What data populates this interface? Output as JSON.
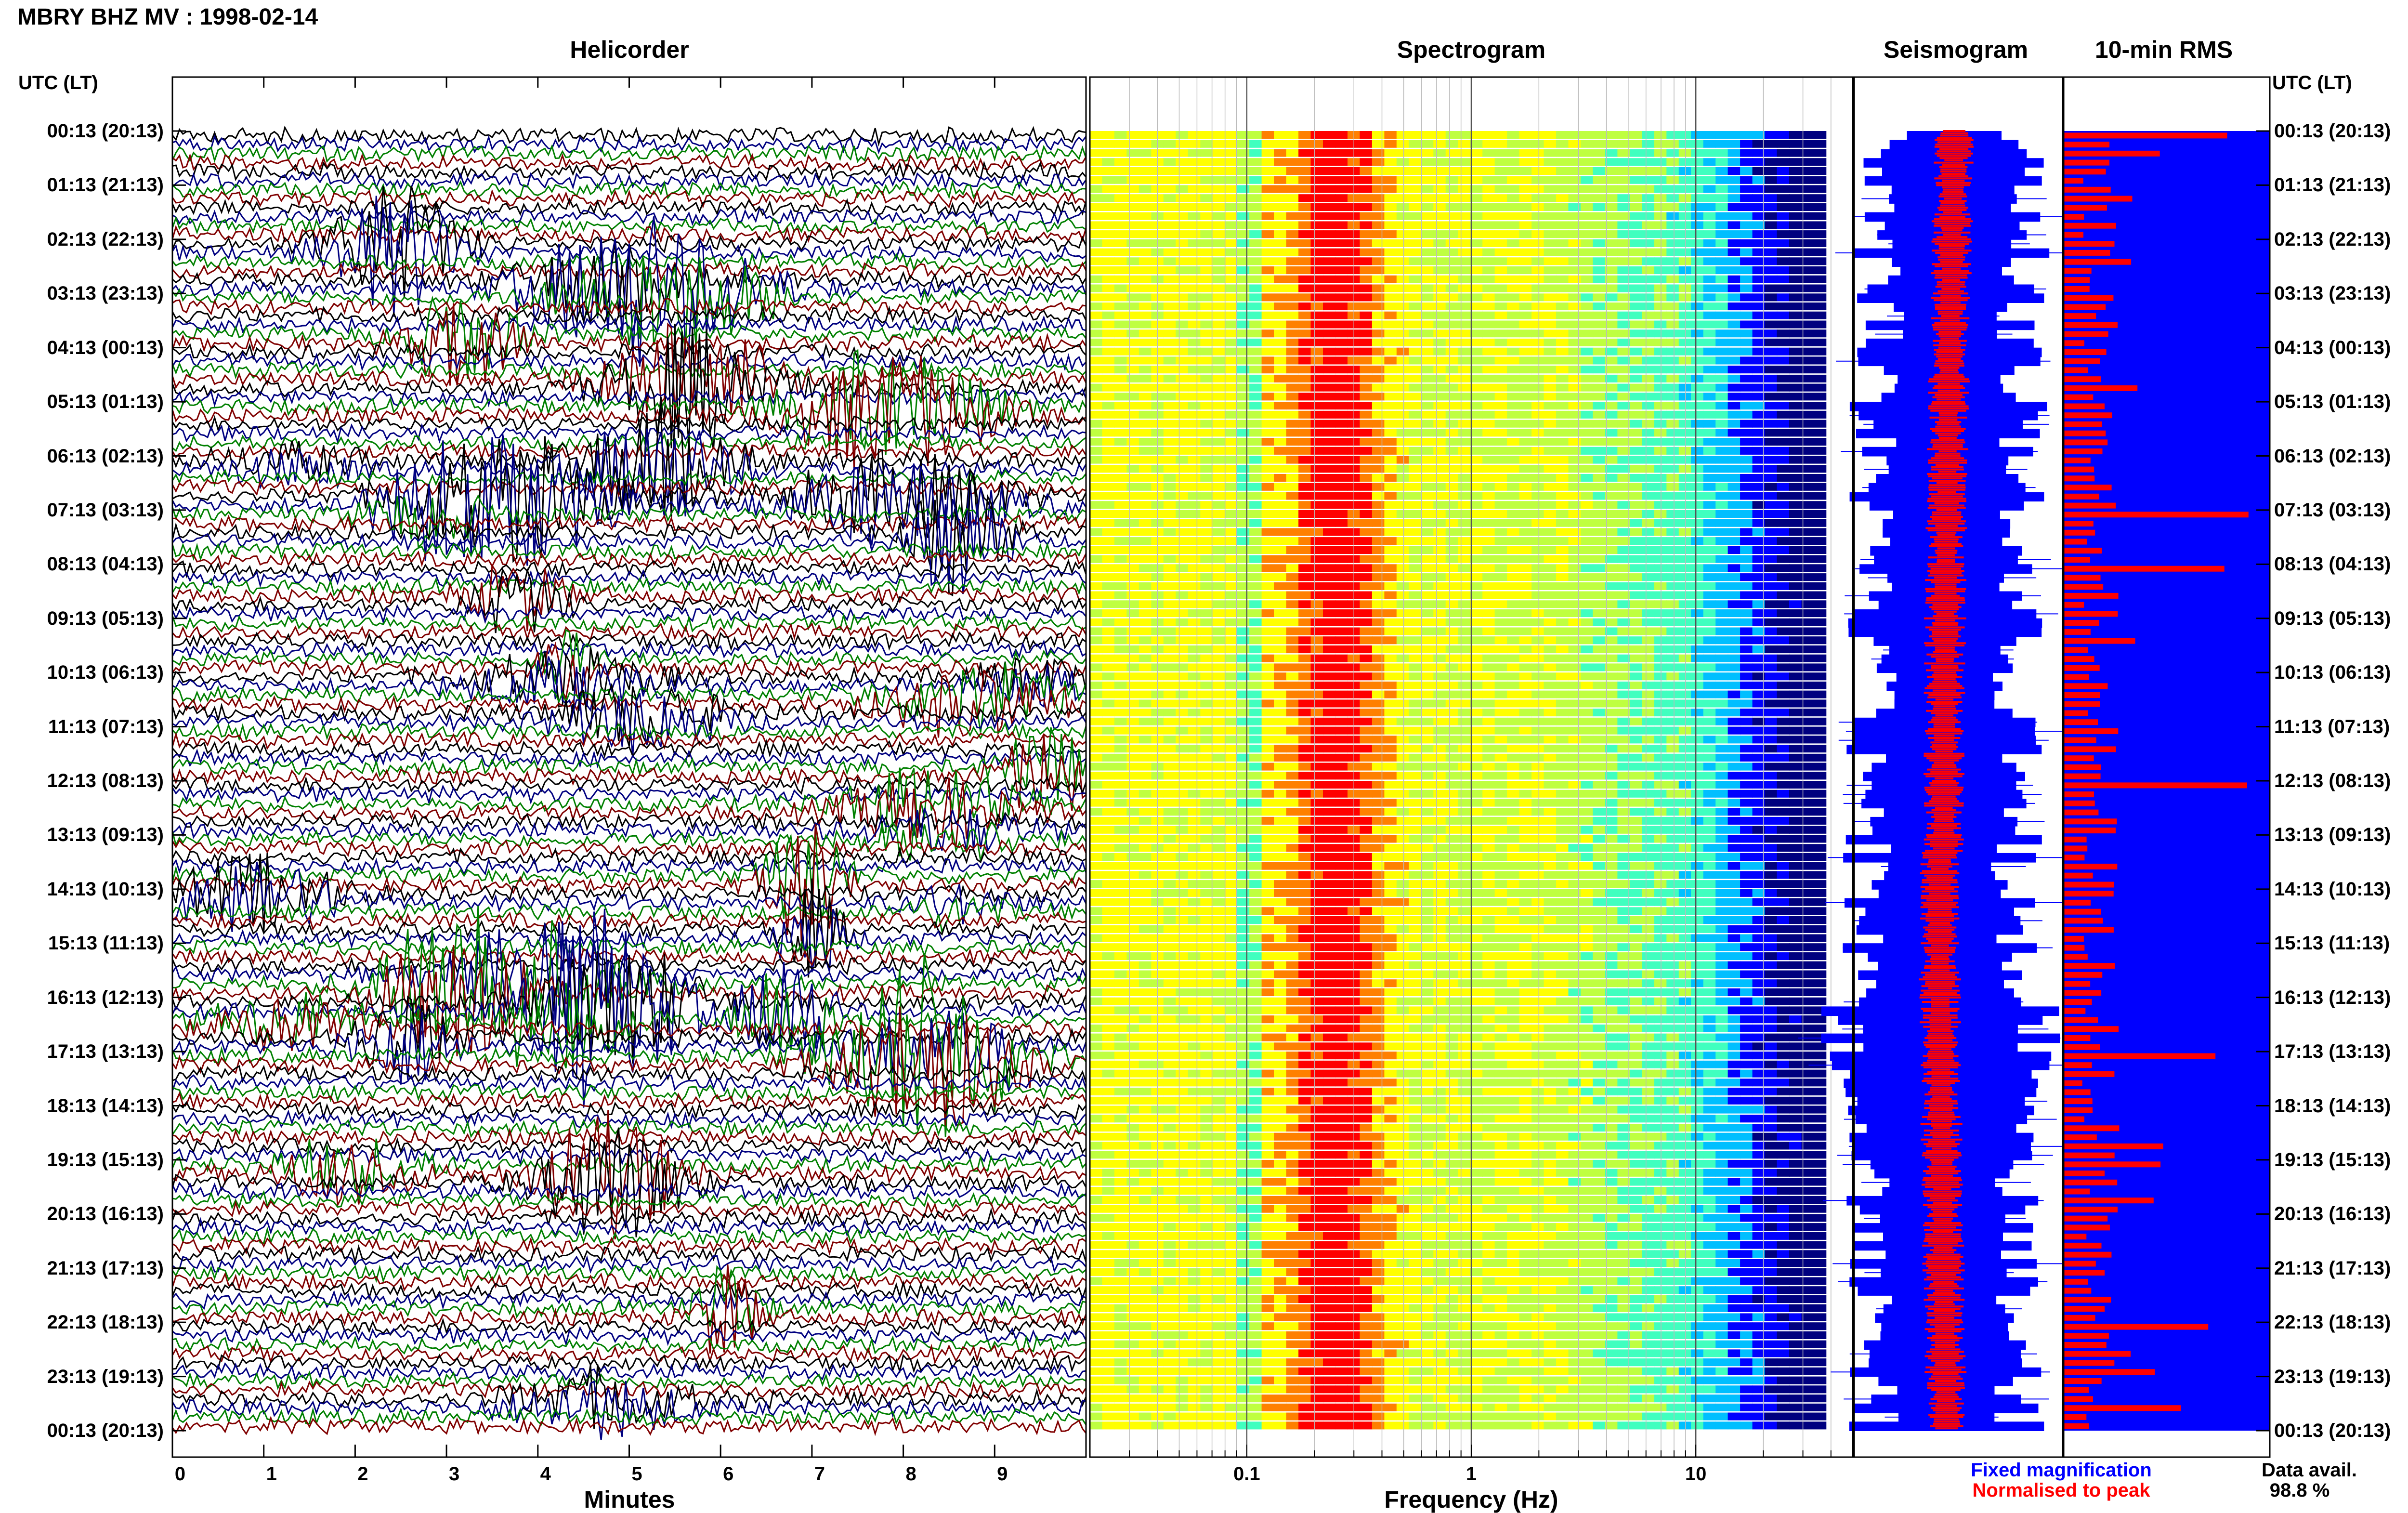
{
  "title": "MBRY BHZ MV : 1998-02-14",
  "panels": {
    "helicorder": "Helicorder",
    "spectrogram": "Spectrogram",
    "seismogram": "Seismogram",
    "rms": "10-min RMS"
  },
  "y_axis_label": "UTC (LT)",
  "colors": {
    "helicorder_traces": [
      "#000000",
      "#000080",
      "#008000",
      "#800000"
    ],
    "fixed_magnification": "#0000ff",
    "normalised_to_peak": "#ff0000",
    "spectrogram_colormap": [
      "#00007f",
      "#0000ff",
      "#00bfff",
      "#40ffbf",
      "#bfff40",
      "#ffff00",
      "#ff8000",
      "#ff0000"
    ]
  },
  "legend": {
    "fixed": "Fixed magnification",
    "normalised": "Normalised to peak"
  },
  "data_availability": {
    "label": "Data avail.",
    "value": "98.8 %"
  },
  "chart_data": [
    {
      "type": "line",
      "title": "Helicorder",
      "xlabel": "Minutes",
      "x_ticks": [
        "0",
        "1",
        "2",
        "3",
        "4",
        "5",
        "6",
        "7",
        "8",
        "9"
      ],
      "xlim": [
        0,
        10
      ],
      "ylabel": "UTC (LT)",
      "y_tick_labels": [
        "00:13 (20:13)",
        "01:13 (21:13)",
        "02:13 (22:13)",
        "03:13 (23:13)",
        "04:13 (00:13)",
        "05:13 (01:13)",
        "06:13 (02:13)",
        "07:13 (03:13)",
        "08:13 (04:13)",
        "09:13 (05:13)",
        "10:13 (06:13)",
        "11:13 (07:13)",
        "12:13 (08:13)",
        "13:13 (09:13)",
        "14:13 (10:13)",
        "15:13 (11:13)",
        "16:13 (12:13)",
        "17:13 (13:13)",
        "18:13 (14:13)",
        "19:13 (15:13)",
        "20:13 (16:13)",
        "21:13 (17:13)",
        "22:13 (18:13)",
        "23:13 (19:13)",
        "00:13 (20:13)"
      ],
      "rows": 144,
      "row_minutes": 10
    },
    {
      "type": "heatmap",
      "title": "Spectrogram",
      "xlabel": "Frequency (Hz)",
      "x_scale": "log",
      "x_ticks": [
        "0.1",
        "1",
        "10"
      ],
      "xlim": [
        0.02,
        50
      ],
      "rows": 144
    },
    {
      "type": "line",
      "title": "Seismogram",
      "series": [
        {
          "name": "Fixed magnification"
        },
        {
          "name": "Normalised to peak"
        }
      ],
      "rows": 144
    },
    {
      "type": "bar",
      "title": "10-min RMS",
      "orientation": "horizontal",
      "rows": 144,
      "notable_peaks_utc": [
        "00:13",
        "07:13",
        "08:13",
        "12:13",
        "17:13",
        "22:13"
      ]
    }
  ]
}
